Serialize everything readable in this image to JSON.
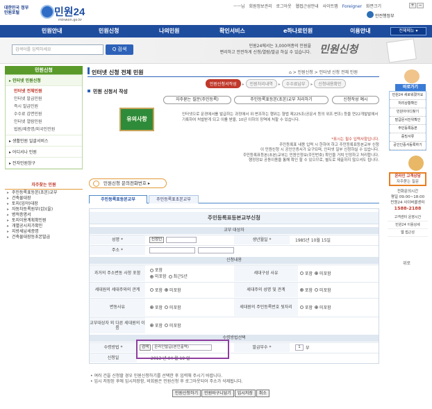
{
  "header": {
    "gov_logo": "대한민국 정부민원포털",
    "site_name": "민원24",
    "site_url": "minwon.go.kr",
    "user_links": [
      "ㅡㅡ님",
      "회원정보관리",
      "로그아웃",
      "웹접근성안내",
      "사이트맵",
      "Foreigner",
      "화면크기"
    ],
    "size_buttons": [
      "+",
      "−"
    ],
    "ministry": "안전행정부"
  },
  "nav": {
    "items": [
      "민원안내",
      "민원신청",
      "나의민원",
      "확인서비스",
      "e하나로민원",
      "이용안내"
    ],
    "all_menu": "전체메뉴 ▾"
  },
  "banner": {
    "search_placeholder": "검색어를 입력하세요",
    "search_button": "Q 검색",
    "text_line1": "민원24에서는 3,000여종의 민원을",
    "text_line2": "편리하고 안전하게 신청/열람/발급 하실 수 있습니다.",
    "title": "민원신청"
  },
  "sidebar": {
    "title": "민원신청",
    "sections": [
      {
        "label": "▸ 인터넷 민원신청",
        "selected": true,
        "subs": [
          "인터넷 전체민원",
          "인터넷 발급민원",
          "즉시 발급민원",
          "수수료 감면민원",
          "인터넷 열람민원",
          "법원/제증명/외국인민원"
        ]
      },
      {
        "label": "▸ 생활민원 일괄서비스",
        "selected": false,
        "subs": []
      },
      {
        "label": "▸ 어디서나 민원",
        "selected": false,
        "subs": []
      },
      {
        "label": "▸ 전자민원창구",
        "selected": false,
        "subs": []
      }
    ],
    "favorites_title": "자주찾는 민원",
    "favorites": [
      "주민등록표등본(초본)교부",
      "건축물대장",
      "토지(임야)대장",
      "자동차등록원부(갑)(을)",
      "병적증명서",
      "토지이용계획확인원",
      "개별공시지가확인",
      "지방세납세증명",
      "건축물대장등초본발급"
    ]
  },
  "main": {
    "page_title": "인터넷 신청 전체 민원",
    "breadcrumb": "⌂ > 민원신청 > 인터넷 신청 전체 민원",
    "steps": [
      "민원신청서작성",
      "민원처리내역",
      "수수료납부",
      "신청내용확인"
    ],
    "section_title": "민원 신청서 작성",
    "faq_button": "자주묻는 질문(주민등록)",
    "guide_button": "주민등록표등본(초본)교부 처리하기",
    "sample_button": "신청작성 예시",
    "notice_img_text": "유의사항",
    "notice_text": "인터넷으로 문경에서를 발급하는 과정에서 위·변조하는 행위는 형법 제225조(공문서 등의 위조·변조) 등을 연22개발발에서 기록하여 처벌받게 되고 이를 받을, 10년 이하의 징역에 처할 수 있습니다.",
    "info_line1": "*표시는 필수 입력사항입니다.",
    "info_line2": "주민등록표 내용 입력 시 한하여 하고 주민등록표등본교부 신청",
    "info_line3": "이 민원신청 시 공인인증서가 요구되며, 인터넷 일부 신청하실 수 있습니다.",
    "info_line4": "주민등록표등본(초본)교부는 민원인정보(주민번호) 확인을 거쳐 인정하고 처리합니다.",
    "info_line5": "행정정보 공동이용을 통해 확인 할 수 있으므로, 별도로 제출하지 않으셔도 됩니다.",
    "call_button": "민원신청 문의전화번호 ▸",
    "tabs": [
      "주민등록표등본교부",
      "주민등록표초본교부"
    ]
  },
  "form": {
    "title": "주민등록표등본교부신청",
    "sec_applicant": "교부 대상자",
    "name_label": "성명 *",
    "name_button": "신청인",
    "ssn_label": "생년월일 *",
    "ssn_value": "1985년 10월 15일",
    "address_label": "주소 *",
    "sec_content": "신청내용",
    "past_addr_label": "과거의 주소변동 사항 포함",
    "past_addr_opts": [
      "포함",
      "미포함",
      "최근5년"
    ],
    "relation_label": "세대구성 사유",
    "relation_opts": [
      "포함",
      "미포함"
    ],
    "household_label": "세대원의 세대주와의 관계",
    "household_opts": [
      "포함",
      "미포함"
    ],
    "head_label": "세대주의 성명 및 관계",
    "head_opts": [
      "포함",
      "미포함"
    ],
    "ssn_back_label": "세대원의 주민등록번호 뒷자리",
    "ssn_back_opts": [
      "포함",
      "미포함"
    ],
    "change_label": "변동사유",
    "change_opts": [
      "포함",
      "미포함"
    ],
    "other_label": "교부대상자 외 다른 세대원의 이름",
    "other_opts": [
      "포함",
      "미포함"
    ],
    "other2_label": "교부대상자 외 다른 세대원의 주민등록번호 뒷자리",
    "other2_opts": [
      "포함",
      "미포함"
    ],
    "sec_receive": "수령방법선택",
    "receive_label": "수령방법 *",
    "receive_value": "온라인발급(본인출력)",
    "receive_button": "검색",
    "copies_label": "발급부수 *",
    "copies_value": "1",
    "copies_unit": "부",
    "date_label": "신청일",
    "date_value": "2013 년 04 월 19 일"
  },
  "bottom": {
    "note1": "• 여러 건을 신청할 경우 민원신청하기를 선택한 후 입력해 주시기 바랍니다.",
    "note2": "• 임시 저장된 후에 임시저장함, 비회원은 민원신청 후 로그아웃되어 주소가 삭제됩니다.",
    "buttons": [
      "민원신청하기",
      "민원바구니담기",
      "임시저장",
      "취소"
    ]
  },
  "right_rail": {
    "title": "바로가기",
    "items": [
      "민원24 새로워졌어요",
      "처리상황확인",
      "민원아이디찾기",
      "발급문서진위확인",
      "주민등록등본",
      "증빙서류",
      "공인인증서등록하기"
    ],
    "center_title": "온라인 고객상담",
    "center_sub": "자주묻는 질문",
    "hours_label": "전화문의시간",
    "hours_value": "평일 09:00~18:00",
    "phone_label": "민원24 사이버콜센터",
    "phone": "1588-2188",
    "links": [
      "고객센터 운영시간",
      "민원24 이용상세",
      "웹 접근성"
    ],
    "top": "위로"
  }
}
